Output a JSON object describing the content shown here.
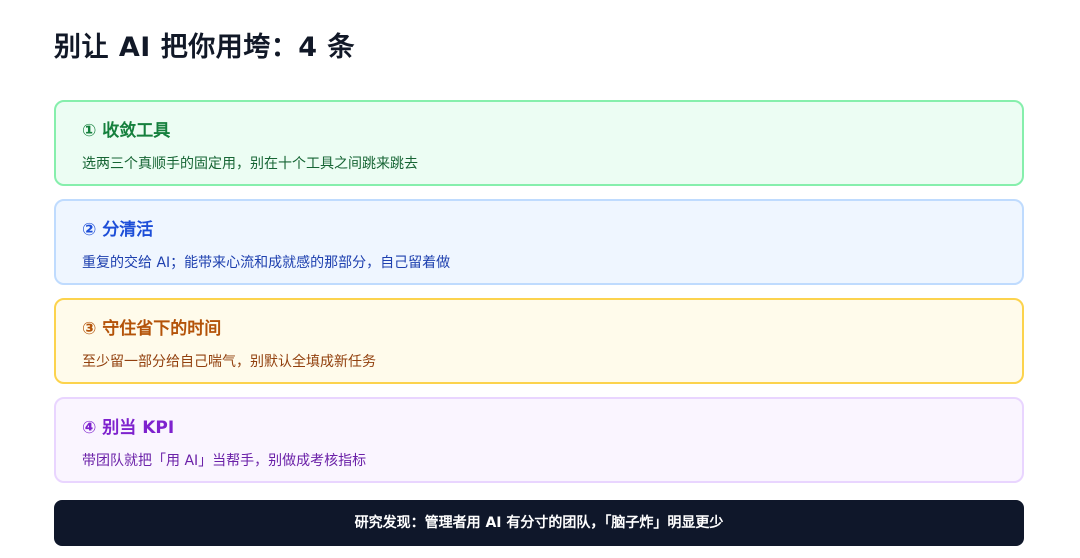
{
  "title": "别让 AI 把你用垮：4 条",
  "cards": [
    {
      "title": "① 收敛工具",
      "desc": "选两三个真顺手的固定用，别在十个工具之间跳来跳去",
      "accent": "#15803d",
      "background": "#ecfdf3",
      "border": "#86efac"
    },
    {
      "title": "② 分清活",
      "desc": "重复的交给 AI；能带来心流和成就感的那部分，自己留着做",
      "accent": "#1d4ed8",
      "background": "#eff6ff",
      "border": "#bfdbfe"
    },
    {
      "title": "③ 守住省下的时间",
      "desc": "至少留一部分给自己喘气，别默认全填成新任务",
      "accent": "#b45309",
      "background": "#fffbeb",
      "border": "#fcd34d"
    },
    {
      "title": "④ 别当 KPI",
      "desc": "带团队就把「用 AI」当帮手，别做成考核指标",
      "accent": "#7e22ce",
      "background": "#faf5ff",
      "border": "#e9d5ff"
    }
  ],
  "footer": {
    "text": "研究发现：管理者用 AI 有分寸的团队，「脑子炸」明显更少",
    "background": "#0f172a"
  }
}
